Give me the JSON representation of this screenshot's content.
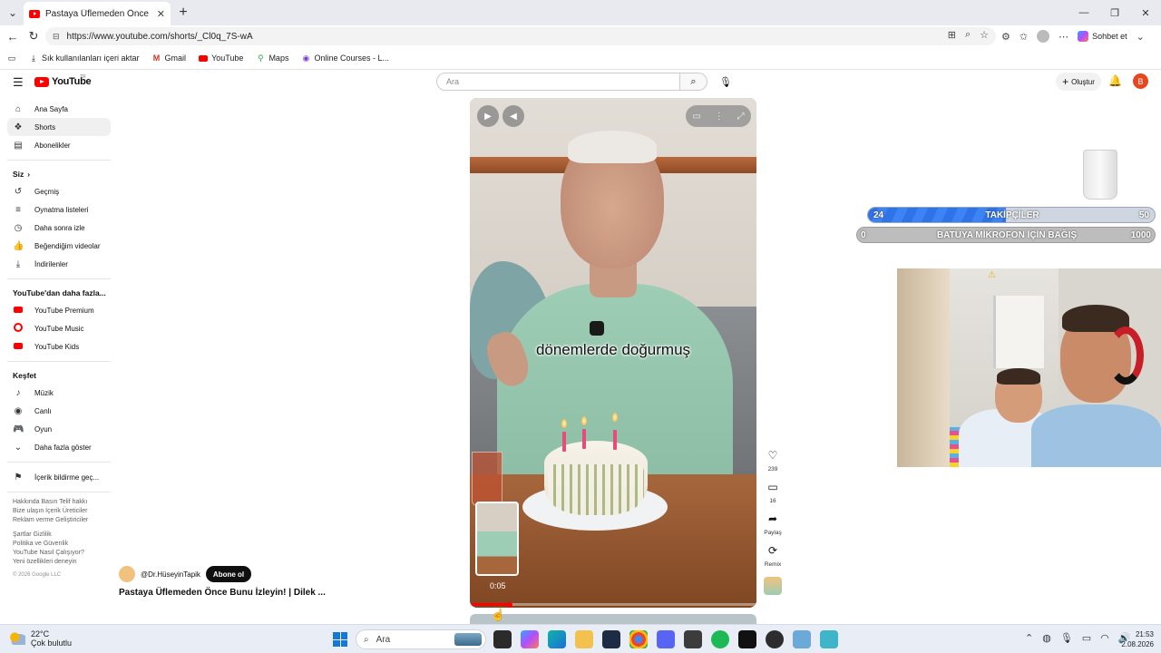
{
  "browser": {
    "tab_title": "Pastaya Üflemeden Önce Bunu İzle",
    "url": "https://www.youtube.com/shorts/_Cl0q_7S-wA",
    "copilot_label": "Sohbet et",
    "bookmarks": [
      "Sık kullanılanları içeri aktar",
      "Gmail",
      "YouTube",
      "Maps",
      "Online Courses - L..."
    ]
  },
  "youtube": {
    "logo_text": "YouTube",
    "logo_country": "TR",
    "search_placeholder": "Ara",
    "create_label": "Oluştur",
    "avatar_letter": "B"
  },
  "sidebar": {
    "main": [
      "Ana Sayfa",
      "Shorts",
      "Abonelikler"
    ],
    "you_heading": "Siz",
    "you": [
      "Geçmiş",
      "Oynatma listeleri",
      "Daha sonra izle",
      "Beğendiğim videolar",
      "İndirilenler"
    ],
    "more_heading": "YouTube'dan daha fazla...",
    "more": [
      "YouTube Premium",
      "YouTube Music",
      "YouTube Kids"
    ],
    "explore_heading": "Keşfet",
    "explore": [
      "Müzik",
      "Canlı",
      "Oyun",
      "Daha fazla göster"
    ],
    "report": "İçerik bildirme geç...",
    "footer1": [
      "Hakkında  Basın  Telif hakkı",
      "Bize ulaşın  İçerik Üreticiler",
      "Reklam verme  Geliştiriciler"
    ],
    "footer2": [
      "Şartlar  Gizlilik",
      "Politika ve Güvenlik",
      "YouTube Nasıl Çalışıyor?",
      "Yeni özellikleri deneyin"
    ],
    "copyright": "© 2026 Google LLC"
  },
  "short": {
    "caption": "dönemlerde doğurmuş",
    "time": "0:05",
    "progress": 0.14,
    "channel": "@Dr.HüseyinTapik",
    "subscribe_label": "Abone ol",
    "title": "Pastaya Üflemeden Önce Bunu İzleyin! | Dilek ...",
    "likes": "239",
    "comments": "16",
    "share_label": "Paylaş",
    "remix_label": "Remix"
  },
  "overlays": {
    "goal1": {
      "current": "24",
      "label": "TAKİPÇİLER",
      "target": "50",
      "fraction": 0.48
    },
    "goal2": {
      "current": "0",
      "label": "BATUYA MİKROFON İÇİN BAĞIŞ",
      "target": "1000",
      "fraction": 0
    }
  },
  "taskbar": {
    "temperature": "22°C",
    "weather": "Çok bulutlu",
    "search_label": "Ara",
    "time": "21:53",
    "date": "2.08.2026"
  },
  "colors": {
    "youtube_red": "#ff0000",
    "goal_blue": "#2f72ea"
  }
}
